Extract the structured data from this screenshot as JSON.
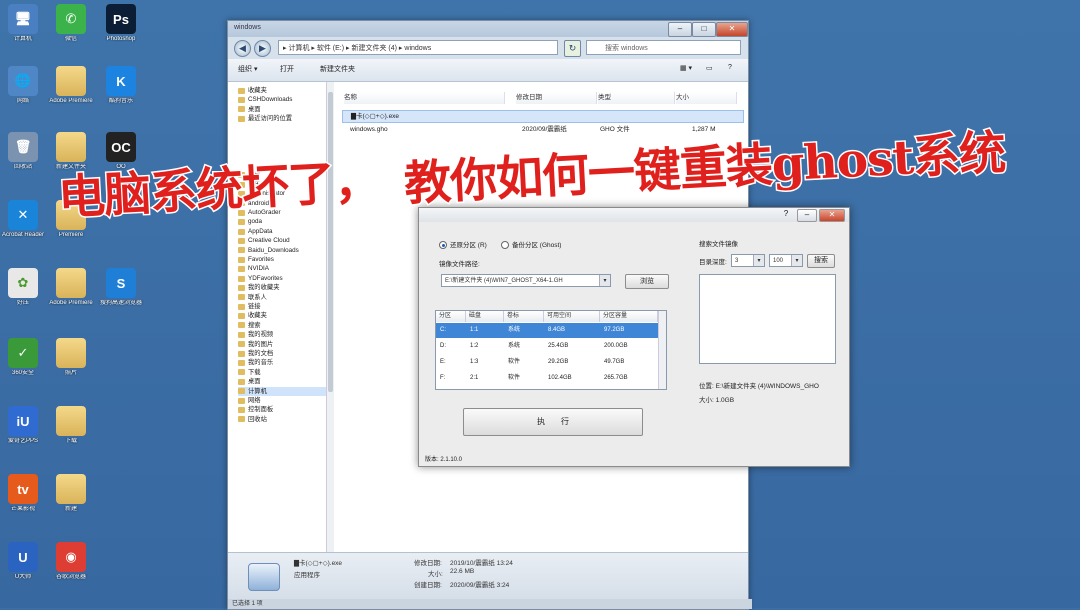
{
  "desktop": {
    "icons": [
      {
        "label": "计算机",
        "glyph": "🖥"
      },
      {
        "label": "微信",
        "glyph": "✆"
      },
      {
        "label": "Photoshop",
        "glyph": "Ps"
      },
      {
        "label": "网络",
        "glyph": "🌐"
      },
      {
        "label": "Adobe Premiere",
        "glyph": ""
      },
      {
        "label": "酷狗音乐",
        "glyph": "K"
      },
      {
        "label": "回收站",
        "glyph": "🗑"
      },
      {
        "label": "新建文件夹",
        "glyph": ""
      },
      {
        "label": "OO",
        "glyph": "OC"
      },
      {
        "label": "Acrobat Reader",
        "glyph": "✕"
      },
      {
        "label": "Premiere",
        "glyph": ""
      },
      {
        "label": "好压",
        "glyph": "✿"
      },
      {
        "label": "Adobe Premiere",
        "glyph": ""
      },
      {
        "label": "搜狗高速浏览器",
        "glyph": "S"
      },
      {
        "label": "360安全",
        "glyph": "✓"
      },
      {
        "label": "照片",
        "glyph": ""
      },
      {
        "label": "爱奇艺PPS",
        "glyph": "iU"
      },
      {
        "label": "下载",
        "glyph": ""
      },
      {
        "label": "芒果影视",
        "glyph": "tv"
      },
      {
        "label": "新建",
        "glyph": ""
      },
      {
        "label": "U大师",
        "glyph": "U"
      },
      {
        "label": "谷歌浏览器",
        "glyph": "◉"
      }
    ]
  },
  "explorer": {
    "title": "windows",
    "address": "▸ 计算机 ▸ 软件 (E:) ▸ 新建文件夹 (4) ▸ windows",
    "search_placeholder": "搜索 windows",
    "toolbar": {
      "organize": "组织 ▾",
      "open": "打开",
      "new_folder": "新建文件夹"
    },
    "columns": {
      "name": "名称",
      "date": "修改日期",
      "type": "类型",
      "size": "大小"
    },
    "files": [
      {
        "name": "▇卡(◇▢+◇).exe",
        "date": "",
        "type": "",
        "size": ""
      },
      {
        "name": "windows.gho",
        "date": "2020/09/震霸纸",
        "type": "GHO 文件",
        "size": "1,287 M"
      }
    ],
    "nav_items": [
      "收藏夹",
      "CSHDownloads",
      "桌面",
      "最近访问的位置",
      "",
      "",
      "",
      "",
      "",
      "文档",
      "音乐",
      "Administrator",
      "android",
      "AutoGrader",
      "goda",
      "AppData",
      "Creative Cloud",
      "Baidu_Downloads",
      "Favorites",
      "NVIDIA",
      "YDFavorites",
      "我的收藏夹",
      "联系人",
      "链接",
      "收藏夹",
      "搜索",
      "我的视频",
      "我的图片",
      "我的文档",
      "我的音乐",
      "下载",
      "桌面",
      "计算机",
      "网络",
      "控制面板",
      "回收站"
    ],
    "selected_nav": "计算机",
    "details": {
      "name": "▇卡(◇▢+◇).exe",
      "kind": "应用程序",
      "modified_label": "修改日期:",
      "modified": "2019/10/震霸纸 13:24",
      "size_label": "大小:",
      "size": "22.6 MB",
      "created_label": "创建日期:",
      "created": "2020/09/震霸纸 3:24"
    },
    "status": "已选择 1 项"
  },
  "dialog": {
    "radio_restore": "还原分区 (R)",
    "radio_backup": "备份分区 (Ghost)",
    "image_path_label": "镜像文件路径:",
    "image_path": "E:\\新建文件夹 (4)\\WIN7_GHOST_X64-1.GH",
    "browse": "浏览",
    "table_headers": [
      "分区",
      "磁盘",
      "卷标",
      "可用空间",
      "分区容量"
    ],
    "partitions": [
      {
        "p": "C:",
        "disk": "1:1",
        "label": "系统",
        "free": "8.4GB",
        "cap": "97.2GB"
      },
      {
        "p": "D:",
        "disk": "1:2",
        "label": "系统",
        "free": "25.4GB",
        "cap": "200.0GB"
      },
      {
        "p": "E:",
        "disk": "1:3",
        "label": "软件",
        "free": "29.2GB",
        "cap": "49.7GB"
      },
      {
        "p": "F:",
        "disk": "2:1",
        "label": "软件",
        "free": "102.4GB",
        "cap": "265.7GB"
      }
    ],
    "execute": "执　　行",
    "search_group": "搜索文件镜像",
    "search_depth_label": "目录深度:",
    "depth_a": "3",
    "depth_b": "100",
    "search_btn": "搜索",
    "location_label": "位置:",
    "location": "E:\\新建文件夹 (4)\\WINDOWS_GHO",
    "size_label": "大小:",
    "size": "1.0GB",
    "version": "版本: 2.1.10.0"
  },
  "banner": {
    "left": "电脑系统坏了，",
    "right": "教你如何一键重装ghost系统"
  },
  "colors": {
    "banner_red": "#e0201c",
    "desktop_blue": "#3a6ea5",
    "selection_blue": "#3f86d6"
  }
}
